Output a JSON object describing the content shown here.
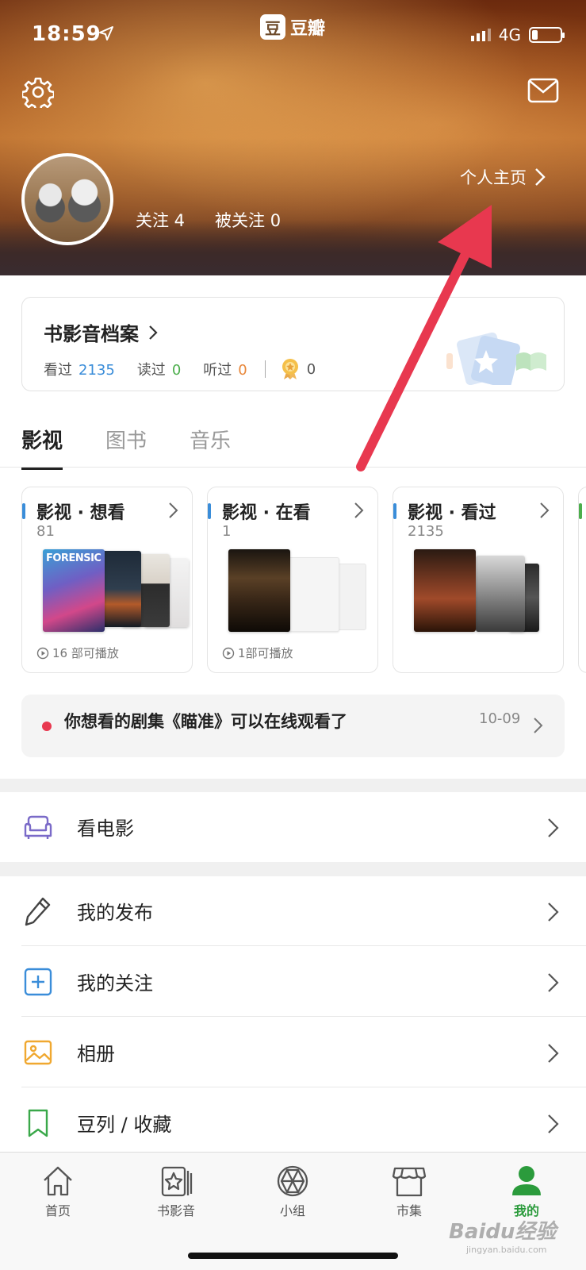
{
  "status_bar": {
    "time": "18:59",
    "network": "4G",
    "battery_level": 0.2
  },
  "app": {
    "logo_char": "豆",
    "name": "豆瓣"
  },
  "header": {
    "following_label": "关注 4",
    "followers_label": "被关注 0",
    "homepage_label": "个人主页",
    "settings_icon": "gear-icon",
    "mail_icon": "mail-icon"
  },
  "archive": {
    "title": "书影音档案",
    "stats": [
      {
        "label": "看过",
        "value": "2135",
        "color": "#3a8dd9"
      },
      {
        "label": "读过",
        "value": "0",
        "color": "#4cae4c"
      },
      {
        "label": "听过",
        "value": "0",
        "color": "#e8873a"
      }
    ],
    "medal_count": "0"
  },
  "tabs": [
    {
      "label": "影视",
      "active": true
    },
    {
      "label": "图书",
      "active": false
    },
    {
      "label": "音乐",
      "active": false
    }
  ],
  "shelves": [
    {
      "title": "影视 · 想看",
      "count": "81",
      "playable": "16 部可播放",
      "accent": "#3a8dd9"
    },
    {
      "title": "影视 · 在看",
      "count": "1",
      "playable": "1部可播放",
      "accent": "#3a8dd9"
    },
    {
      "title": "影视 · 看过",
      "count": "2135",
      "playable": "",
      "accent": "#3a8dd9"
    }
  ],
  "poster_text": {
    "forensic": "FORENSIC"
  },
  "notice": {
    "text": "你想看的剧集《瞄准》可以在线观看了",
    "date": "10-09"
  },
  "menu": [
    {
      "label": "看电影",
      "icon": "sofa-icon"
    },
    {
      "label": "我的发布",
      "icon": "pencil-icon"
    },
    {
      "label": "我的关注",
      "icon": "plus-square-icon"
    },
    {
      "label": "相册",
      "icon": "photo-icon"
    },
    {
      "label": "豆列 / 收藏",
      "icon": "bookmark-icon"
    }
  ],
  "bottom_nav": [
    {
      "label": "首页",
      "icon": "home-icon",
      "active": false
    },
    {
      "label": "书影音",
      "icon": "media-icon",
      "active": false
    },
    {
      "label": "小组",
      "icon": "group-icon",
      "active": false
    },
    {
      "label": "市集",
      "icon": "market-icon",
      "active": false
    },
    {
      "label": "我的",
      "icon": "profile-icon",
      "active": true
    }
  ],
  "colors": {
    "accent_green": "#2b9b3c",
    "arrow_red": "#e8384f",
    "header_brown": "#9a4a18"
  },
  "watermark": {
    "main": "Baidu经验",
    "sub": "jingyan.baidu.com"
  }
}
